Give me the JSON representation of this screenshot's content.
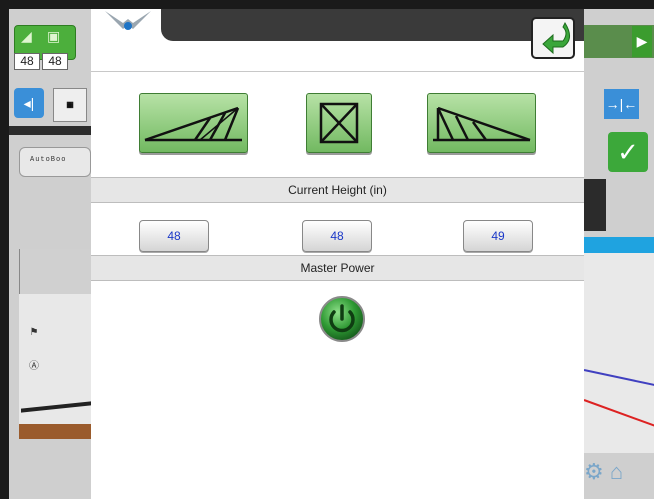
{
  "background": {
    "left_heights": [
      "48",
      "48"
    ],
    "autoboom_label": "AutoBoo"
  },
  "popup": {
    "section_height_title": "Current Height (in)",
    "heights": [
      "48",
      "48",
      "49"
    ],
    "section_power_title": "Master Power"
  },
  "icons": {
    "close": "return-arrow-icon",
    "boom_left": "boom-left-raise-icon",
    "boom_center": "boom-center-icon",
    "boom_right": "boom-right-raise-icon",
    "power": "power-icon"
  },
  "colors": {
    "button_green": "#72b961",
    "height_text": "#1b38c8",
    "header_bg": "#e6e6e6"
  }
}
